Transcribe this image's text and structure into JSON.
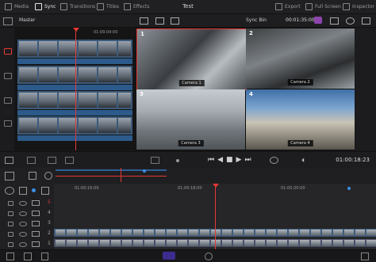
{
  "topbar": {
    "tabs": [
      {
        "label": "Media",
        "icon": "media-icon"
      },
      {
        "label": "Sync",
        "icon": "sync-icon"
      },
      {
        "label": "Transitions",
        "icon": "transitions-icon"
      },
      {
        "label": "Titles",
        "icon": "titles-icon"
      },
      {
        "label": "Effects",
        "icon": "effects-icon"
      }
    ],
    "project_title": "Test",
    "right": [
      {
        "label": "Export",
        "icon": "export-icon"
      },
      {
        "label": "Full Screen",
        "icon": "fullscreen-icon"
      },
      {
        "label": "Inspector",
        "icon": "inspector-icon"
      }
    ]
  },
  "secondbar": {
    "master_label": "Master",
    "sync_bin_label": "Sync Bin",
    "timecode": "00:01:35:00"
  },
  "source": {
    "timecode": "01:00:04:00"
  },
  "cameras": [
    {
      "number": "1",
      "label": "Camera 1"
    },
    {
      "number": "2",
      "label": "Camera 2"
    },
    {
      "number": "3",
      "label": "Camera 3"
    },
    {
      "number": "4",
      "label": "Camera 4"
    }
  ],
  "transport": {
    "timecode": "01:00:18:23"
  },
  "timeline": {
    "ruler": [
      "01:00:16:00",
      "01:00:18:00",
      "01:00:20:00"
    ],
    "tracks": [
      "5",
      "4",
      "3",
      "2",
      "1"
    ]
  },
  "colors": {
    "accent_red": "#e53935",
    "accent_blue": "#3a8ee6",
    "clip_blue": "#3d5a7c"
  }
}
